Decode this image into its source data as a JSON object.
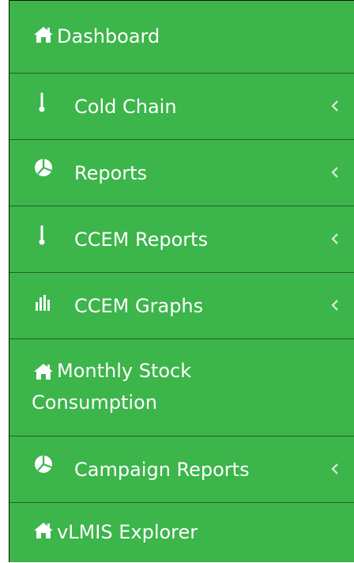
{
  "sidebar": {
    "items": [
      {
        "label": "Dashboard",
        "icon": "home-icon",
        "has_children": false
      },
      {
        "label": "Cold Chain",
        "icon": "thermometer-icon",
        "has_children": true
      },
      {
        "label": "Reports",
        "icon": "pie-chart-icon",
        "has_children": true
      },
      {
        "label": "CCEM Reports",
        "icon": "thermometer-icon",
        "has_children": true
      },
      {
        "label": "CCEM Graphs",
        "icon": "bar-chart-icon",
        "has_children": true
      },
      {
        "label": "Monthly Stock Consumption",
        "icon": "home-icon",
        "has_children": false
      },
      {
        "label": "Campaign Reports",
        "icon": "pie-chart-icon",
        "has_children": true
      },
      {
        "label": "vLMIS Explorer",
        "icon": "home-icon",
        "has_children": false
      }
    ],
    "colors": {
      "background": "#3cb54a",
      "divider": "#21622b",
      "text": "#ffffff",
      "chevron": "#cfead2"
    }
  }
}
